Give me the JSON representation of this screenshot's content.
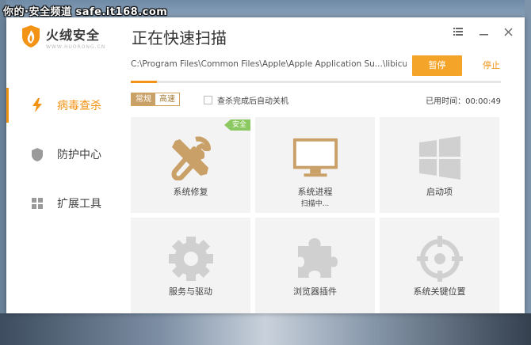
{
  "watermark": "你的·安全频道 safe.it168.com",
  "app": {
    "name": "火绒安全",
    "subtitle": "WWW.HUORONG.CN"
  },
  "sidebar": {
    "items": [
      {
        "label": "病毒查杀",
        "icon": "lightning-icon",
        "active": true
      },
      {
        "label": "防护中心",
        "icon": "shield-icon",
        "active": false
      },
      {
        "label": "扩展工具",
        "icon": "grid-icon",
        "active": false
      }
    ]
  },
  "header": {
    "title": "正在快速扫描",
    "controls": [
      "menu-icon",
      "minimize-icon",
      "close-icon"
    ]
  },
  "scan": {
    "current_path": "C:\\Program Files\\Common Files\\Apple\\Apple Application Su...\\libicuin.dll",
    "pause_label": "暂停",
    "stop_label": "停止",
    "progress_percent": 7
  },
  "options": {
    "modes": [
      "常规",
      "高速"
    ],
    "selected_mode": "常规",
    "auto_shutdown_label": "查杀完成后自动关机",
    "auto_shutdown_checked": false,
    "elapsed_label": "已用时间：00:00:49"
  },
  "tiles": [
    {
      "label": "系统修复",
      "icon": "tools-icon",
      "status": "",
      "badge": "安全"
    },
    {
      "label": "系统进程",
      "icon": "monitor-icon",
      "status": "扫描中...",
      "badge": ""
    },
    {
      "label": "启动项",
      "icon": "windows-icon",
      "status": "",
      "badge": ""
    },
    {
      "label": "服务与驱动",
      "icon": "gear-icon",
      "status": "",
      "badge": ""
    },
    {
      "label": "浏览器插件",
      "icon": "puzzle-icon",
      "status": "",
      "badge": ""
    },
    {
      "label": "系统关键位置",
      "icon": "target-icon",
      "status": "",
      "badge": ""
    }
  ],
  "colors": {
    "accent": "#f39316",
    "safe": "#8cc861",
    "icon_active": "#c9a068",
    "icon_idle": "#d0d0d0"
  }
}
